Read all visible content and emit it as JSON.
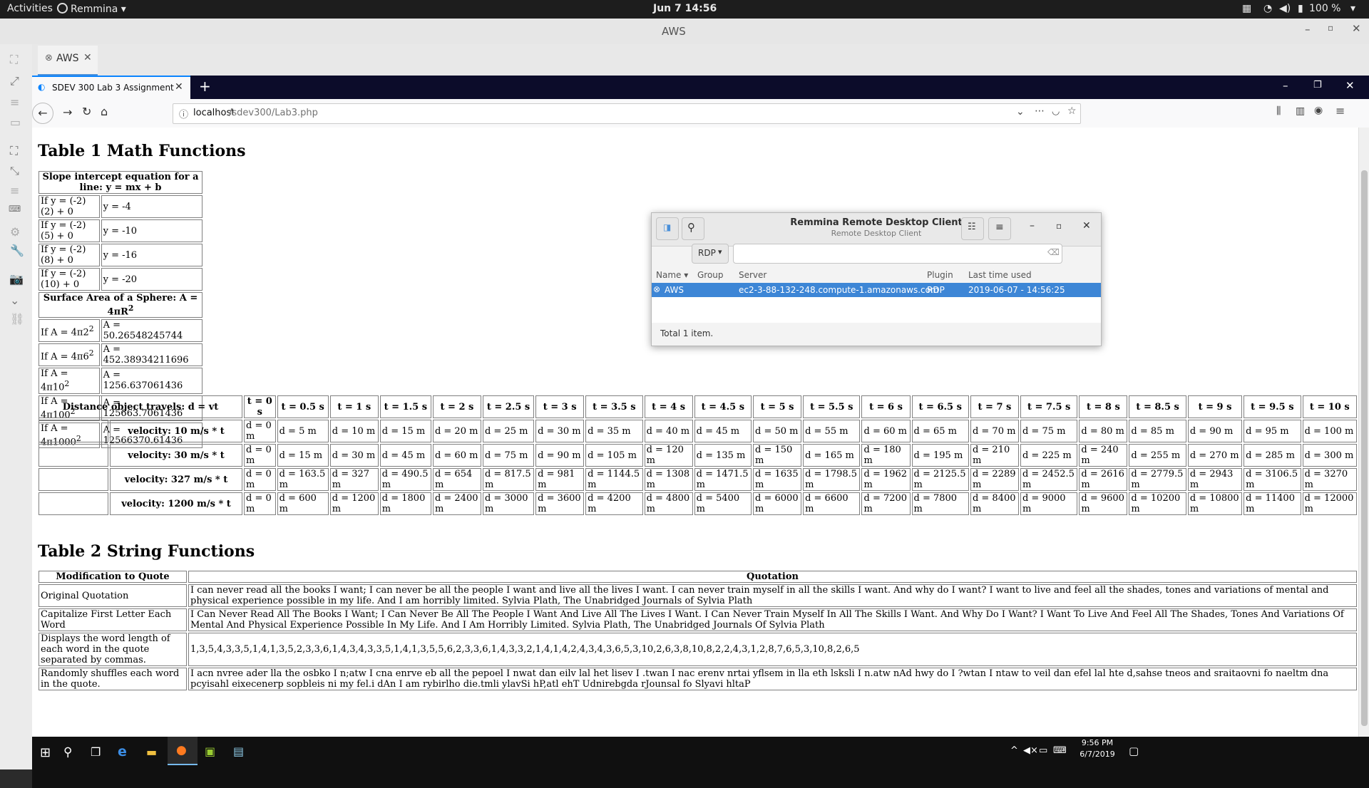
{
  "topbar": {
    "activities": "Activities",
    "app": "Remmina",
    "clock": "Jun 7  14:56",
    "battery": "100 %"
  },
  "remmina": {
    "title": "AWS",
    "tab_label": "AWS"
  },
  "firefox": {
    "tab_title": "SDEV 300 Lab 3 Assignment",
    "url_host": "localhost",
    "url_path": "/sdev300/Lab3.php"
  },
  "page": {
    "table1_title": "Table 1 Math Functions",
    "table2_title": "Table 2 String Functions",
    "slope_header": "Slope intercept equation for a line: y = mx + b",
    "slope_rows": [
      [
        "If y = (-2)(2) + 0",
        "y = -4"
      ],
      [
        "If y = (-2)(5) + 0",
        "y = -10"
      ],
      [
        "If y = (-2)(8) + 0",
        "y = -16"
      ],
      [
        "If y = (-2)(10) + 0",
        "y = -20"
      ]
    ],
    "sphere_header": "Surface Area of a Sphere: A = 4πR",
    "sphere_sup": "2",
    "sphere_rows": [
      [
        "If A = 4π2",
        "A = 50.26548245744"
      ],
      [
        "If A = 4π6",
        "A = 452.38934211696"
      ],
      [
        "If A = 4π10",
        "A = 1256.637061436"
      ],
      [
        "If A = 4π100",
        "A = 125663.7061436"
      ],
      [
        "If A = 4π1000",
        "A = 12566370.61436"
      ]
    ],
    "distance_header": "Distance object travels: d = vt",
    "time_headers": [
      "t = 0 s",
      "t = 0.5 s",
      "t = 1 s",
      "t = 1.5 s",
      "t = 2 s",
      "t = 2.5 s",
      "t = 3 s",
      "t = 3.5 s",
      "t = 4 s",
      "t = 4.5 s",
      "t = 5 s",
      "t = 5.5 s",
      "t = 6 s",
      "t = 6.5 s",
      "t = 7 s",
      "t = 7.5 s",
      "t = 8 s",
      "t = 8.5 s",
      "t = 9 s",
      "t = 9.5 s",
      "t = 10 s"
    ],
    "velocity_rows": [
      {
        "label": "velocity: 10 m/s * t",
        "values": [
          "d = 0 m",
          "d = 5 m",
          "d = 10 m",
          "d = 15 m",
          "d = 20 m",
          "d = 25 m",
          "d = 30 m",
          "d = 35 m",
          "d = 40 m",
          "d = 45 m",
          "d = 50 m",
          "d = 55 m",
          "d = 60 m",
          "d = 65 m",
          "d = 70 m",
          "d = 75 m",
          "d = 80 m",
          "d = 85 m",
          "d = 90 m",
          "d = 95 m",
          "d = 100 m"
        ]
      },
      {
        "label": "velocity: 30 m/s * t",
        "values": [
          "d = 0 m",
          "d = 15 m",
          "d = 30 m",
          "d = 45 m",
          "d = 60 m",
          "d = 75 m",
          "d = 90 m",
          "d = 105 m",
          "d = 120 m",
          "d = 135 m",
          "d = 150 m",
          "d = 165 m",
          "d = 180 m",
          "d = 195 m",
          "d = 210 m",
          "d = 225 m",
          "d = 240 m",
          "d = 255 m",
          "d = 270 m",
          "d = 285 m",
          "d = 300 m"
        ]
      },
      {
        "label": "velocity: 327 m/s * t",
        "values": [
          "d = 0 m",
          "d = 163.5 m",
          "d = 327 m",
          "d = 490.5 m",
          "d = 654 m",
          "d = 817.5 m",
          "d = 981 m",
          "d = 1144.5 m",
          "d = 1308 m",
          "d = 1471.5 m",
          "d = 1635 m",
          "d = 1798.5 m",
          "d = 1962 m",
          "d = 2125.5 m",
          "d = 2289 m",
          "d = 2452.5 m",
          "d = 2616 m",
          "d = 2779.5 m",
          "d = 2943 m",
          "d = 3106.5 m",
          "d = 3270 m"
        ]
      },
      {
        "label": "velocity: 1200 m/s * t",
        "values": [
          "d = 0 m",
          "d = 600 m",
          "d = 1200 m",
          "d = 1800 m",
          "d = 2400 m",
          "d = 3000 m",
          "d = 3600 m",
          "d = 4200 m",
          "d = 4800 m",
          "d = 5400 m",
          "d = 6000 m",
          "d = 6600 m",
          "d = 7200 m",
          "d = 7800 m",
          "d = 8400 m",
          "d = 9000 m",
          "d = 9600 m",
          "d = 10200 m",
          "d = 10800 m",
          "d = 11400 m",
          "d = 12000 m"
        ]
      }
    ],
    "string_headers": [
      "Modification to Quote",
      "Quotation"
    ],
    "string_rows": [
      [
        "Original Quotation",
        "I can never read all the books I want; I can never be all the people I want and live all the lives I want. I can never train myself in all the skills I want.  And why do I want? I want to live and feel all the shades, tones and variations of mental and physical experience possible in my life.  And I am horribly limited.  Sylvia Plath, The Unabridged Journals of Sylvia Plath"
      ],
      [
        "Capitalize First Letter Each Word",
        "I Can Never Read All The Books I Want; I Can Never Be All The People I Want And Live All The Lives I Want.  I Can Never Train Myself In All The Skills I Want.  And Why Do I Want? I Want To Live And Feel All The Shades, Tones And Variations Of Mental And Physical Experience Possible In My Life.  And I Am Horribly Limited.  Sylvia Plath, The Unabridged Journals Of Sylvia Plath"
      ],
      [
        "Displays the word length of each word in the quote separated by commas.",
        "1,3,5,4,3,3,5,1,4,1,3,5,2,3,3,6,1,4,3,4,3,3,5,1,4,1,3,5,5,6,2,3,3,6,1,4,3,3,2,1,4,1,4,2,4,3,4,3,6,5,3,10,2,6,3,8,10,8,2,2,4,3,1,2,8,7,6,5,3,10,8,2,6,5"
      ],
      [
        "Randomly shuffles each word in the quote.",
        "I acn nvree ader lla the osbko I n;atw I cna enrve eb all the pepoel I nwat dan eilv lal het lisev I .twan I nac erenv nrtai yflsem in lla eth lsksli I n.atw nAd hwy do I ?wtan I ntaw to veil dan efel lal hte d,sahse tneos and sraitaovni fo naeltm dna pcyisahl eixecenerp sopbleis ni my fel.i dAn I am rybirlho die.tmli ylavSi hP,atl ehT Udnirebgda rJounsal fo Slyavi hltaP"
      ]
    ]
  },
  "dialog": {
    "title": "Remmina Remote Desktop Client",
    "subtitle": "Remote Desktop Client",
    "protocol": "RDP",
    "columns": [
      "Name",
      "Group",
      "Server",
      "Plugin",
      "Last time used"
    ],
    "row": {
      "name": "AWS",
      "group": "",
      "server": "ec2-3-88-132-248.compute-1.amazonaws.com",
      "plugin": "RDP",
      "last_used": "2019-06-07 - 14:56:25"
    },
    "footer": "Total 1 item."
  },
  "taskbar": {
    "time": "9:56 PM",
    "date": "6/7/2019"
  }
}
